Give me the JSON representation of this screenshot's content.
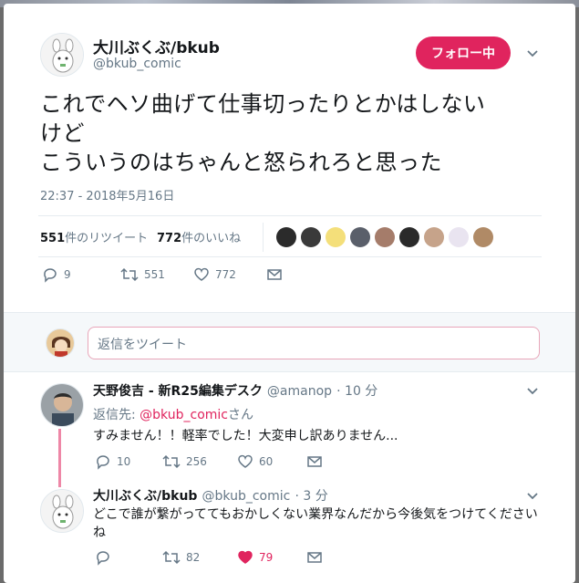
{
  "main": {
    "author_name": "大川ぶくぶ/bkub",
    "author_handle": "@bkub_comic",
    "follow_label": "フォロー中",
    "text": "これでヘソ曲げて仕事切ったりとかはしない\nけど\nこういうのはちゃんと怒られろと思った",
    "timestamp": "22:37 - 2018年5月16日",
    "retweet_count": "551",
    "retweet_label": "件のリツイート",
    "like_count": "772",
    "like_label": "件のいいね",
    "actions": {
      "reply": "9",
      "retweet": "551",
      "like": "772"
    }
  },
  "reply_box": {
    "placeholder": "返信をツイート"
  },
  "replies": [
    {
      "name": "天野俊吉 - 新R25編集デスク",
      "handle": "@amanop",
      "time": "· 10 分",
      "reply_to_prefix": "返信先: ",
      "reply_to_handle": "@bkub_comic",
      "reply_to_suffix": "さん",
      "text": "すみません！！軽率でした！大変申し訳ありません...",
      "actions": {
        "reply": "10",
        "retweet": "256",
        "like": "60"
      }
    },
    {
      "name": "大川ぶくぶ/bkub",
      "handle": "@bkub_comic",
      "time": "· 3 分",
      "text": "どこで誰が繋がっててもおかしくない業界なんだから今後気をつけてくださいね",
      "actions": {
        "reply": "",
        "retweet": "82",
        "like": "79"
      }
    }
  ],
  "colors": {
    "accent": "#e0245e",
    "muted": "#657786",
    "text": "#14171a"
  }
}
